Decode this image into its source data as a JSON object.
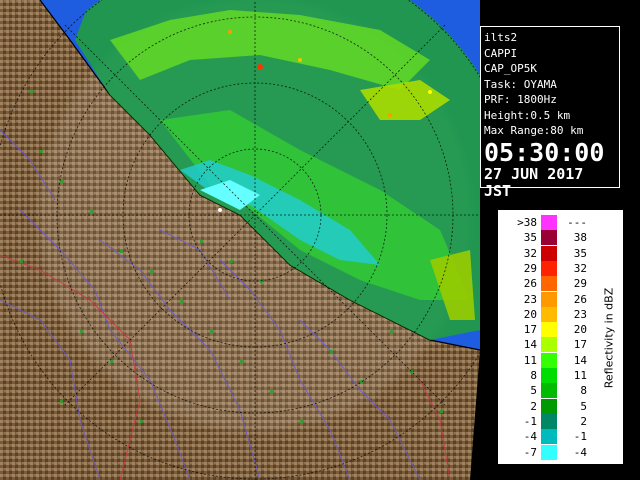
{
  "info": {
    "station": "ilts2",
    "product": "CAPPI",
    "product_code": "CAP_OP5K",
    "task": "Task: OYAMA",
    "prf": "PRF: 1800Hz",
    "height": "Height:0.5 km",
    "max_range": "Max Range:80 km",
    "time": "05:30:00",
    "date": "27 JUN 2017 JST"
  },
  "legend": {
    "unit_label": "Reflectivity in dBZ",
    "rows": [
      {
        "left": ">38",
        "right": "---",
        "color": "#ff33ff"
      },
      {
        "left": "35",
        "right": "38",
        "color": "#990033"
      },
      {
        "left": "32",
        "right": "35",
        "color": "#cc0000"
      },
      {
        "left": "29",
        "right": "32",
        "color": "#ff2200"
      },
      {
        "left": "26",
        "right": "29",
        "color": "#ff6600"
      },
      {
        "left": "23",
        "right": "26",
        "color": "#ff9900"
      },
      {
        "left": "20",
        "right": "23",
        "color": "#ffbb00"
      },
      {
        "left": "17",
        "right": "20",
        "color": "#ffff00"
      },
      {
        "left": "14",
        "right": "17",
        "color": "#aaff00"
      },
      {
        "left": "11",
        "right": "14",
        "color": "#33ff00"
      },
      {
        "left": "8",
        "right": "11",
        "color": "#00dd00"
      },
      {
        "left": "5",
        "right": "8",
        "color": "#00bb00"
      },
      {
        "left": "2",
        "right": "5",
        "color": "#009900"
      },
      {
        "left": "-1",
        "right": "2",
        "color": "#008866"
      },
      {
        "left": "-4",
        "right": "-1",
        "color": "#00bbbb"
      },
      {
        "left": "-7",
        "right": "-4",
        "color": "#33ffff"
      }
    ]
  },
  "colors": {
    "sea": "#1f5de0",
    "terrain_dark": "#6b5033",
    "terrain_light": "#a08360",
    "range_ring": "#000000"
  }
}
